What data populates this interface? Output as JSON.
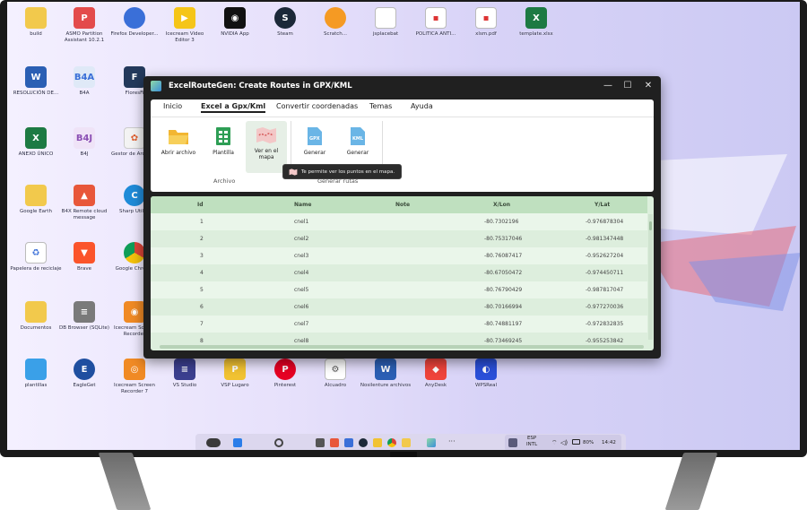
{
  "desktop": {
    "icons": [
      {
        "label": "build"
      },
      {
        "label": "ASMO Partition Assistant 10.2.1"
      },
      {
        "label": "Firefox Developer..."
      },
      {
        "label": "Icecream Video Editor 3"
      },
      {
        "label": "NVIDIA App"
      },
      {
        "label": "Steam"
      },
      {
        "label": "Scratch..."
      },
      {
        "label": "jsplacebat"
      },
      {
        "label": "POLITICA ANTI..."
      },
      {
        "label": "xlsm.pdf"
      },
      {
        "label": "template.xlsx"
      },
      {
        "label": "RESOLUCIÓN DE..."
      },
      {
        "label": "B4A"
      },
      {
        "label": "FloresFi"
      },
      {
        "label": "ANEXO ÚNICO"
      },
      {
        "label": "B4J"
      },
      {
        "label": "Gestor de Archivos"
      },
      {
        "label": "Google Earth"
      },
      {
        "label": "B4X Remote cloud message"
      },
      {
        "label": "Sharp Utility"
      },
      {
        "label": "Papelera de reciclaje"
      },
      {
        "label": "Brave"
      },
      {
        "label": "Google Chrome"
      },
      {
        "label": "Documentos"
      },
      {
        "label": "DB Browser (SQLite)"
      },
      {
        "label": "Icecream Screen Recorder"
      },
      {
        "label": "plantillas"
      },
      {
        "label": "EagleGet"
      },
      {
        "label": "Icecream Screen Recorder 7"
      },
      {
        "label": "VS Studio"
      },
      {
        "label": "VSP Lugaro"
      },
      {
        "label": "Pinterest"
      },
      {
        "label": "Alcuadro"
      },
      {
        "label": "Nosilenture archivos"
      },
      {
        "label": "AnyDesk"
      },
      {
        "label": "WPSReal"
      }
    ]
  },
  "window": {
    "title": "ExcelRouteGen: Create Routes in GPX/KML",
    "minimize": "—",
    "maximize": "☐",
    "close": "✕",
    "tabs": [
      {
        "label": "Inicio"
      },
      {
        "label": "Excel a Gpx/Kml"
      },
      {
        "label": "Convertir coordenadas"
      },
      {
        "label": "Temas"
      },
      {
        "label": "Ayuda"
      }
    ],
    "ribbon": {
      "abrir": "Abrir archivo",
      "plantilla": "Plantilla",
      "ver_mapa_1": "Ver en el",
      "ver_mapa_2": "mapa",
      "generar_gpx": "Generar",
      "generar_kml": "Generar",
      "group_archivo": "Archivo",
      "group_rutas": "Generar rutas"
    },
    "tooltip": "Te permite ver los puntos en el mapa."
  },
  "table": {
    "columns": [
      "Id",
      "Name",
      "Note",
      "X/Lon",
      "Y/Lat"
    ],
    "rows": [
      {
        "id": "1",
        "name": "cnel1",
        "note": "",
        "lon": "-80.7302196",
        "lat": "-0.976878304"
      },
      {
        "id": "2",
        "name": "cnel2",
        "note": "",
        "lon": "-80.75317046",
        "lat": "-0.981347448"
      },
      {
        "id": "3",
        "name": "cnel3",
        "note": "",
        "lon": "-80.76087417",
        "lat": "-0.952627204"
      },
      {
        "id": "4",
        "name": "cnel4",
        "note": "",
        "lon": "-80.67050472",
        "lat": "-0.974450711"
      },
      {
        "id": "5",
        "name": "cnel5",
        "note": "",
        "lon": "-80.76790429",
        "lat": "-0.987817047"
      },
      {
        "id": "6",
        "name": "cnel6",
        "note": "",
        "lon": "-80.70166994",
        "lat": "-0.977270036"
      },
      {
        "id": "7",
        "name": "cnel7",
        "note": "",
        "lon": "-80.74881197",
        "lat": "-0.972832835"
      },
      {
        "id": "8",
        "name": "cnel8",
        "note": "",
        "lon": "-80.73469245",
        "lat": "-0.955253842"
      }
    ]
  },
  "taskbar": {
    "lang_1": "ESP",
    "lang_2": "INTL",
    "battery": "80%",
    "time": "14:42"
  },
  "colors": {
    "window_bg": "#202020",
    "grid_header": "#bfe0bf",
    "grid_row": "#eaf6ea"
  }
}
